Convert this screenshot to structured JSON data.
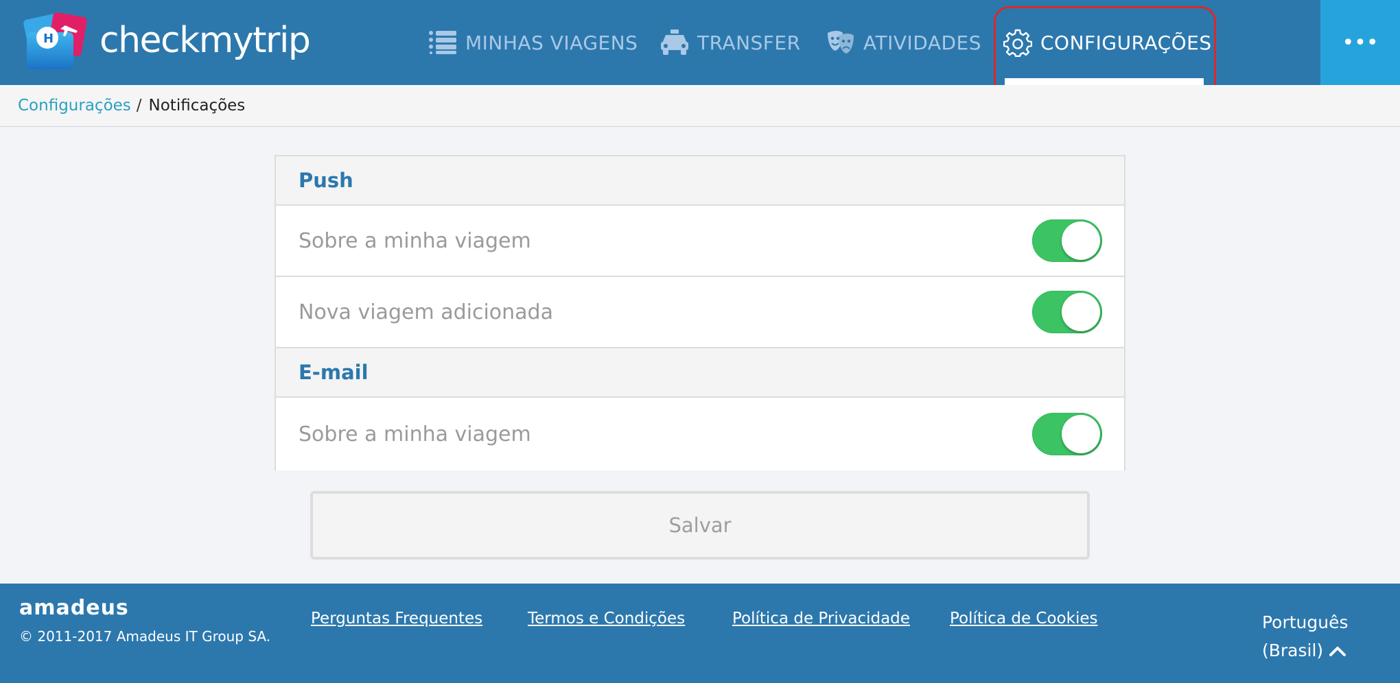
{
  "brand": {
    "name": "checkmytrip",
    "icon": "checkmytrip-logo-icon"
  },
  "nav": {
    "items": [
      {
        "label": "MINHAS VIAGENS",
        "icon": "list-icon"
      },
      {
        "label": "TRANSFER",
        "icon": "car-icon"
      },
      {
        "label": "ATIVIDADES",
        "icon": "theater-masks-icon"
      },
      {
        "label": "CONFIGURAÇÕES",
        "icon": "gear-icon",
        "active": true
      }
    ],
    "more_icon": "more-horizontal-icon",
    "more_label": "•••"
  },
  "breadcrumb": {
    "parent": "Configurações",
    "separator": "/",
    "current": "Notificações"
  },
  "settings": {
    "push": {
      "title": "Push",
      "rows": [
        {
          "label": "Sobre a minha viagem",
          "enabled": true
        },
        {
          "label": "Nova viagem adicionada",
          "enabled": true
        }
      ]
    },
    "email": {
      "title": "E-mail",
      "rows": [
        {
          "label": "Sobre a minha viagem",
          "enabled": true
        }
      ]
    },
    "save_label": "Salvar"
  },
  "footer": {
    "company_logo": "amadeus",
    "copyright": "© 2011-2017 Amadeus IT Group SA.",
    "links": [
      "Perguntas Frequentes",
      "Termos e Condições",
      "Política de Privacidade",
      "Política de Cookies"
    ],
    "language_line1": "Português",
    "language_line2": "(Brasil)"
  },
  "colors": {
    "header_bg": "#2c78ad",
    "more_bg": "#27a3dc",
    "toggle_on": "#3cc464",
    "section_title": "#2b78ad",
    "breadcrumb_link": "#2aa0c2",
    "highlight_border": "#d9292b"
  }
}
